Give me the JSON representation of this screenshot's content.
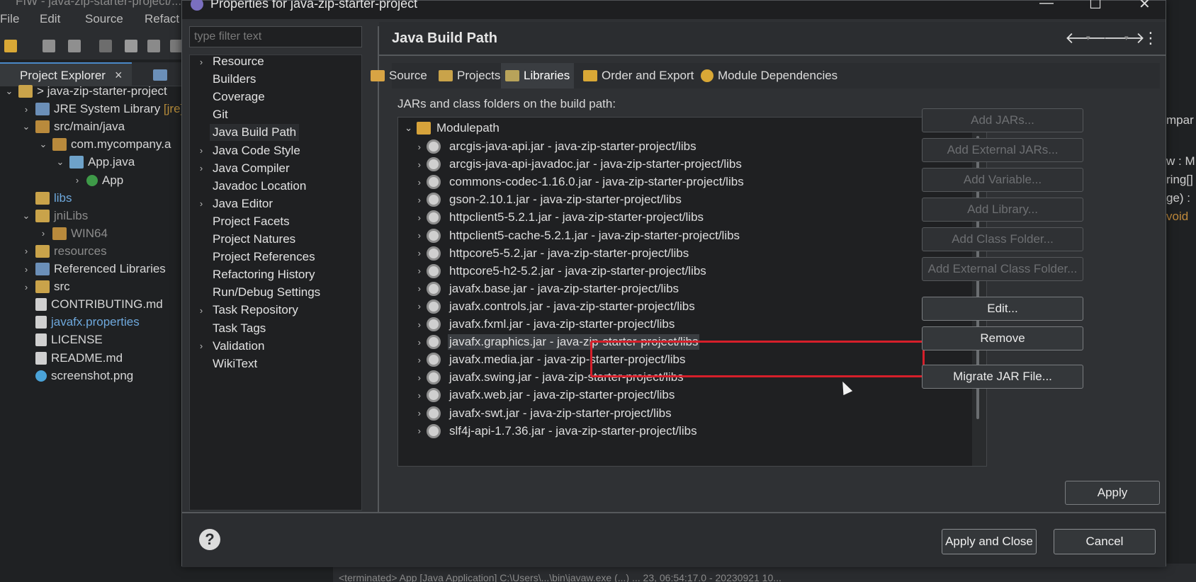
{
  "ide": {
    "title": "FIW - java-zip-starter-project/...",
    "menu": [
      "File",
      "Edit",
      "Source",
      "Refact"
    ],
    "explorer_tab": "Project Explorer",
    "close_glyph": "×",
    "tree": [
      {
        "label": "java-zip-starter-project",
        "prefix": "> ",
        "depth": 0,
        "chev": "⌄",
        "icon": "project-icon",
        "style": ""
      },
      {
        "label": "JRE System Library",
        "suffix": " [jre]",
        "depth": 1,
        "chev": "›",
        "icon": "library-icon",
        "style": ""
      },
      {
        "label": "src/main/java",
        "depth": 1,
        "chev": "⌄",
        "icon": "source-folder-icon",
        "style": ""
      },
      {
        "label": "com.mycompany.a",
        "depth": 2,
        "chev": "⌄",
        "icon": "package-icon",
        "style": ""
      },
      {
        "label": "App.java",
        "depth": 3,
        "chev": "⌄",
        "icon": "java-file-icon",
        "style": ""
      },
      {
        "label": "App",
        "depth": 4,
        "chev": "›",
        "icon": "class-icon",
        "style": ""
      },
      {
        "label": "libs",
        "depth": 1,
        "chev": "",
        "icon": "folder-icon",
        "style": "link"
      },
      {
        "label": "jniLibs",
        "depth": 1,
        "chev": "⌄",
        "icon": "folder-icon",
        "style": "dim"
      },
      {
        "label": "WIN64",
        "depth": 2,
        "chev": "›",
        "icon": "package-icon",
        "style": "dim"
      },
      {
        "label": "resources",
        "depth": 1,
        "chev": "›",
        "icon": "folder-icon",
        "style": "dim"
      },
      {
        "label": "Referenced Libraries",
        "depth": 1,
        "chev": "›",
        "icon": "library-icon",
        "style": ""
      },
      {
        "label": "src",
        "depth": 1,
        "chev": "›",
        "icon": "folder-icon",
        "style": ""
      },
      {
        "label": "CONTRIBUTING.md",
        "depth": 1,
        "chev": "",
        "icon": "markdown-file-icon",
        "style": ""
      },
      {
        "label": "javafx.properties",
        "depth": 1,
        "chev": "",
        "icon": "properties-file-icon",
        "style": "link"
      },
      {
        "label": "LICENSE",
        "depth": 1,
        "chev": "",
        "icon": "text-file-icon",
        "style": ""
      },
      {
        "label": "README.md",
        "depth": 1,
        "chev": "",
        "icon": "markdown-file-icon",
        "style": ""
      },
      {
        "label": "screenshot.png",
        "depth": 1,
        "chev": "",
        "icon": "image-file-icon",
        "style": ""
      }
    ],
    "right_edge_fragments": [
      "mpar",
      "w : M",
      "ring[]",
      "ge) :",
      "void"
    ],
    "bottom_status": "<terminated> App [Java Application] C:\\Users\\...\\bin\\javaw.exe (...) ... 23, 06:54:17.0 - 20230921 10..."
  },
  "dialog": {
    "title": "Properties for java-zip-starter-project",
    "window_buttons": {
      "minimize": "—",
      "maximize": "☐",
      "close": "✕"
    },
    "filter_placeholder": "type filter text",
    "nav_items": [
      {
        "label": "Resource",
        "expandable": true
      },
      {
        "label": "Builders",
        "expandable": false
      },
      {
        "label": "Coverage",
        "expandable": false
      },
      {
        "label": "Git",
        "expandable": false
      },
      {
        "label": "Java Build Path",
        "expandable": false,
        "selected": true
      },
      {
        "label": "Java Code Style",
        "expandable": true
      },
      {
        "label": "Java Compiler",
        "expandable": true
      },
      {
        "label": "Javadoc Location",
        "expandable": false
      },
      {
        "label": "Java Editor",
        "expandable": true
      },
      {
        "label": "Project Facets",
        "expandable": false
      },
      {
        "label": "Project Natures",
        "expandable": false
      },
      {
        "label": "Project References",
        "expandable": false
      },
      {
        "label": "Refactoring History",
        "expandable": false
      },
      {
        "label": "Run/Debug Settings",
        "expandable": false
      },
      {
        "label": "Task Repository",
        "expandable": true
      },
      {
        "label": "Task Tags",
        "expandable": false
      },
      {
        "label": "Validation",
        "expandable": true
      },
      {
        "label": "WikiText",
        "expandable": false
      }
    ],
    "page_title": "Java Build Path",
    "header_buttons": {
      "back": "🡐",
      "forward": "🡒",
      "menu": "⋮",
      "dropdown": "▾"
    },
    "tabs": [
      {
        "label": "Source",
        "icon": "source-tab-icon",
        "color": "#d8a444",
        "active": false
      },
      {
        "label": "Projects",
        "icon": "projects-tab-icon",
        "color": "#c9a34a",
        "active": false
      },
      {
        "label": "Libraries",
        "icon": "libraries-tab-icon",
        "color": "#b8a35a",
        "active": true
      },
      {
        "label": "Order and Export",
        "icon": "order-export-tab-icon",
        "color": "#d9a836",
        "active": false
      },
      {
        "label": "Module Dependencies",
        "icon": "module-dependencies-tab-icon",
        "color": "#d9a836",
        "active": false
      }
    ],
    "section_label": "JARs and class folders on the build path:",
    "modulepath_label": "Modulepath",
    "jars": [
      "arcgis-java-api.jar - java-zip-starter-project/libs",
      "arcgis-java-api-javadoc.jar - java-zip-starter-project/libs",
      "commons-codec-1.16.0.jar - java-zip-starter-project/libs",
      "gson-2.10.1.jar - java-zip-starter-project/libs",
      "httpclient5-5.2.1.jar - java-zip-starter-project/libs",
      "httpclient5-cache-5.2.1.jar - java-zip-starter-project/libs",
      "httpcore5-5.2.jar - java-zip-starter-project/libs",
      "httpcore5-h2-5.2.jar - java-zip-starter-project/libs",
      "javafx.base.jar - java-zip-starter-project/libs",
      "javafx.controls.jar - java-zip-starter-project/libs",
      "javafx.fxml.jar - java-zip-starter-project/libs",
      "javafx.graphics.jar - java-zip-starter-project/libs",
      "javafx.media.jar - java-zip-starter-project/libs",
      "javafx.swing.jar - java-zip-starter-project/libs",
      "javafx.web.jar - java-zip-starter-project/libs",
      "javafx-swt.jar - java-zip-starter-project/libs",
      "slf4j-api-1.7.36.jar - java-zip-starter-project/libs"
    ],
    "selected_jar_index": 11,
    "side_buttons": [
      {
        "label": "Add JARs...",
        "enabled": false,
        "group_gap": false
      },
      {
        "label": "Add External JARs...",
        "enabled": false,
        "group_gap": false
      },
      {
        "label": "Add Variable...",
        "enabled": false,
        "group_gap": false
      },
      {
        "label": "Add Library...",
        "enabled": false,
        "group_gap": false
      },
      {
        "label": "Add Class Folder...",
        "enabled": false,
        "group_gap": false
      },
      {
        "label": "Add External Class Folder...",
        "enabled": false,
        "group_gap": false
      },
      {
        "label": "Edit...",
        "enabled": true,
        "group_gap": true
      },
      {
        "label": "Remove",
        "enabled": true,
        "group_gap": false
      },
      {
        "label": "Migrate JAR File...",
        "enabled": true,
        "group_gap": true
      }
    ],
    "apply_label": "Apply",
    "help_label": "?",
    "apply_close_label": "Apply and Close",
    "cancel_label": "Cancel",
    "colors": {
      "highlight": "#d61f2a",
      "accent": "#4a88c7"
    }
  }
}
